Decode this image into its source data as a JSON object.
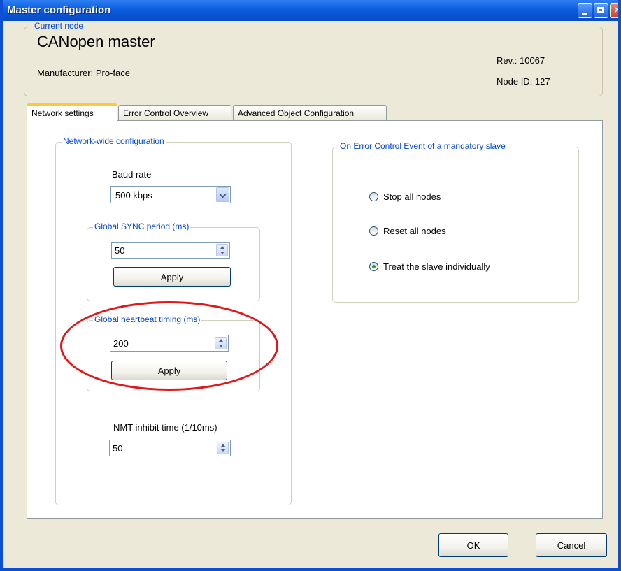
{
  "window": {
    "title": "Master configuration"
  },
  "current_node": {
    "legend": "Current node",
    "name": "CANopen master",
    "manufacturer": "Manufacturer: Pro-face",
    "revision": "Rev.: 10067",
    "node_id": "Node ID: 127"
  },
  "tabs": [
    {
      "label": "Network settings",
      "active": true
    },
    {
      "label": "Error Control Overview",
      "active": false
    },
    {
      "label": "Advanced Object Configuration",
      "active": false
    }
  ],
  "network_config": {
    "legend": "Network-wide configuration",
    "baud_rate_label": "Baud rate",
    "baud_rate_value": "500 kbps",
    "sync": {
      "legend": "Global SYNC period (ms)",
      "value": "50",
      "apply_label": "Apply"
    },
    "heartbeat": {
      "legend": "Global heartbeat timing (ms)",
      "value": "200",
      "apply_label": "Apply"
    },
    "nmt_label": "NMT inhibit time (1/10ms)",
    "nmt_value": "50"
  },
  "error_control": {
    "legend": "On Error Control Event of a mandatory slave",
    "options": [
      {
        "label": "Stop all nodes",
        "checked": false
      },
      {
        "label": "Reset all nodes",
        "checked": false
      },
      {
        "label": "Treat the slave individually",
        "checked": true
      }
    ]
  },
  "footer": {
    "ok_label": "OK",
    "cancel_label": "Cancel"
  },
  "colors": {
    "titlebar": "#0b5fe0",
    "legend_text": "#0046d5",
    "highlight": "#e01818",
    "radio_checked": "#21a121"
  }
}
